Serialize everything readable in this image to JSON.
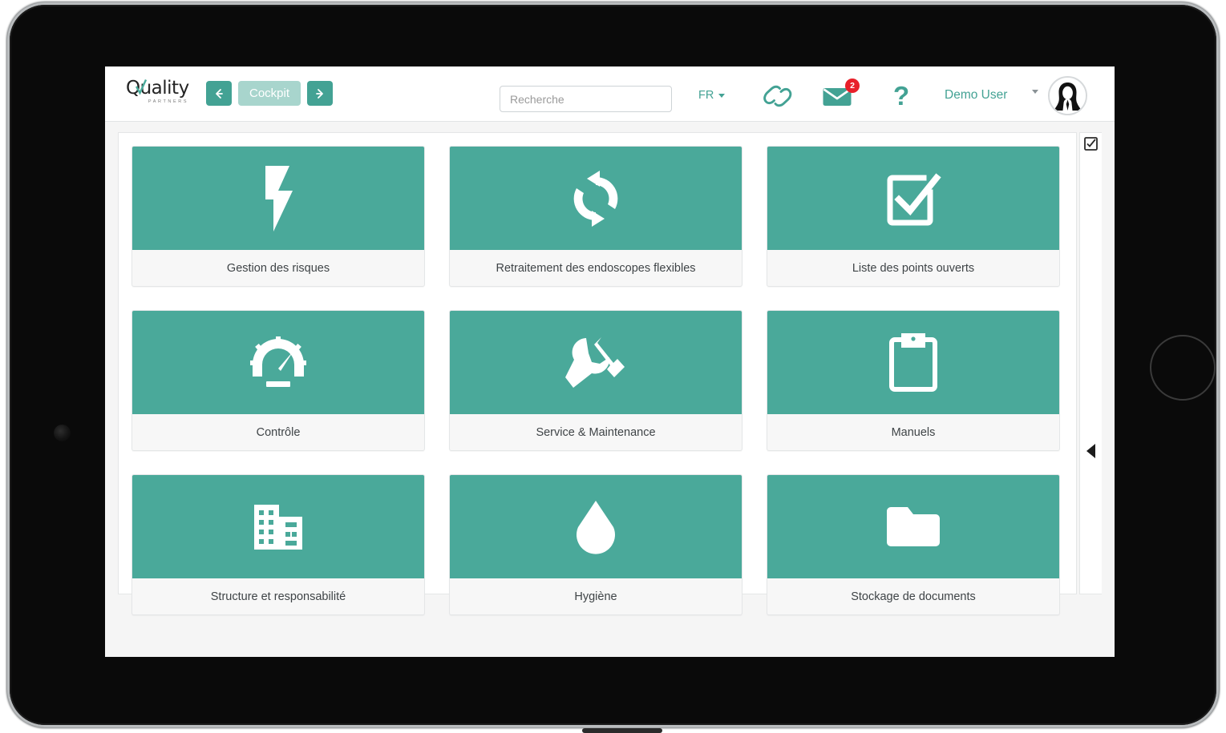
{
  "brand": {
    "logo_word": "Quality",
    "logo_sub": "PARTNERS",
    "accent_color": "#43a294",
    "tile_color": "#4aa99a",
    "badge_color": "#e8202a"
  },
  "topbar": {
    "nav_back_icon": "arrow-left-icon",
    "nav_forward_icon": "arrow-right-icon",
    "page_title": "Cockpit",
    "search": {
      "placeholder": "Recherche",
      "value": ""
    },
    "language": {
      "selected": "FR",
      "caret_icon": "caret-down-icon"
    },
    "link_icon": "chain-link-icon",
    "mail": {
      "icon": "envelope-icon",
      "badge_count": "2"
    },
    "help_label": "?",
    "user": {
      "name": "Demo User",
      "caret_icon": "caret-down-icon",
      "avatar_icon": "avatar-woman-icon"
    }
  },
  "tiles": [
    {
      "label": "Gestion des risques",
      "icon": "lightning-bolt-icon"
    },
    {
      "label": "Retraitement des endoscopes flexibles",
      "icon": "refresh-cycle-icon"
    },
    {
      "label": "Liste des points ouverts",
      "icon": "checkbox-checked-icon"
    },
    {
      "label": "Contrôle",
      "icon": "gauge-icon"
    },
    {
      "label": "Service & Maintenance",
      "icon": "wrench-hammer-icon"
    },
    {
      "label": "Manuels",
      "icon": "clipboard-icon"
    },
    {
      "label": "Structure et responsabilité",
      "icon": "office-building-icon"
    },
    {
      "label": "Hygiène",
      "icon": "water-drop-icon"
    },
    {
      "label": "Stockage de documents",
      "icon": "folder-icon"
    }
  ],
  "right_rail": {
    "checkbox_icon": "checkbox-checked-small-icon",
    "collapse_icon": "triangle-left-icon"
  }
}
